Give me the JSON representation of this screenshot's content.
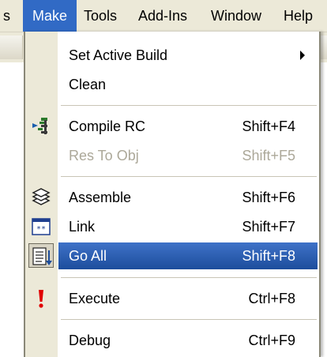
{
  "menubar": {
    "items": [
      {
        "label": "s"
      },
      {
        "label": "Make"
      },
      {
        "label": "Tools"
      },
      {
        "label": "Add-Ins"
      },
      {
        "label": "Window"
      },
      {
        "label": "Help"
      }
    ],
    "active_index": 1
  },
  "menu": {
    "items": [
      {
        "label": "Set Active Build",
        "shortcut": "",
        "icon": "none",
        "submenu": true,
        "enabled": true
      },
      {
        "label": "Clean",
        "shortcut": "",
        "icon": "none",
        "submenu": false,
        "enabled": true
      },
      {
        "label": "Compile RC",
        "shortcut": "Shift+F4",
        "icon": "compile-rc-icon",
        "submenu": false,
        "enabled": true
      },
      {
        "label": "Res To Obj",
        "shortcut": "Shift+F5",
        "icon": "none",
        "submenu": false,
        "enabled": false
      },
      {
        "label": "Assemble",
        "shortcut": "Shift+F6",
        "icon": "assemble-icon",
        "submenu": false,
        "enabled": true
      },
      {
        "label": "Link",
        "shortcut": "Shift+F7",
        "icon": "link-icon",
        "submenu": false,
        "enabled": true
      },
      {
        "label": "Go All",
        "shortcut": "Shift+F8",
        "icon": "go-all-icon",
        "submenu": false,
        "enabled": true,
        "highlighted": true
      },
      {
        "label": "Execute",
        "shortcut": "Ctrl+F8",
        "icon": "exclamation-icon",
        "submenu": false,
        "enabled": true
      },
      {
        "label": "Debug",
        "shortcut": "Ctrl+F9",
        "icon": "none",
        "submenu": false,
        "enabled": true
      }
    ]
  },
  "colors": {
    "highlight": "#316ac5",
    "menubar_bg": "#ece9d8",
    "disabled_text": "#aca899",
    "execute_icon": "#e00000"
  }
}
